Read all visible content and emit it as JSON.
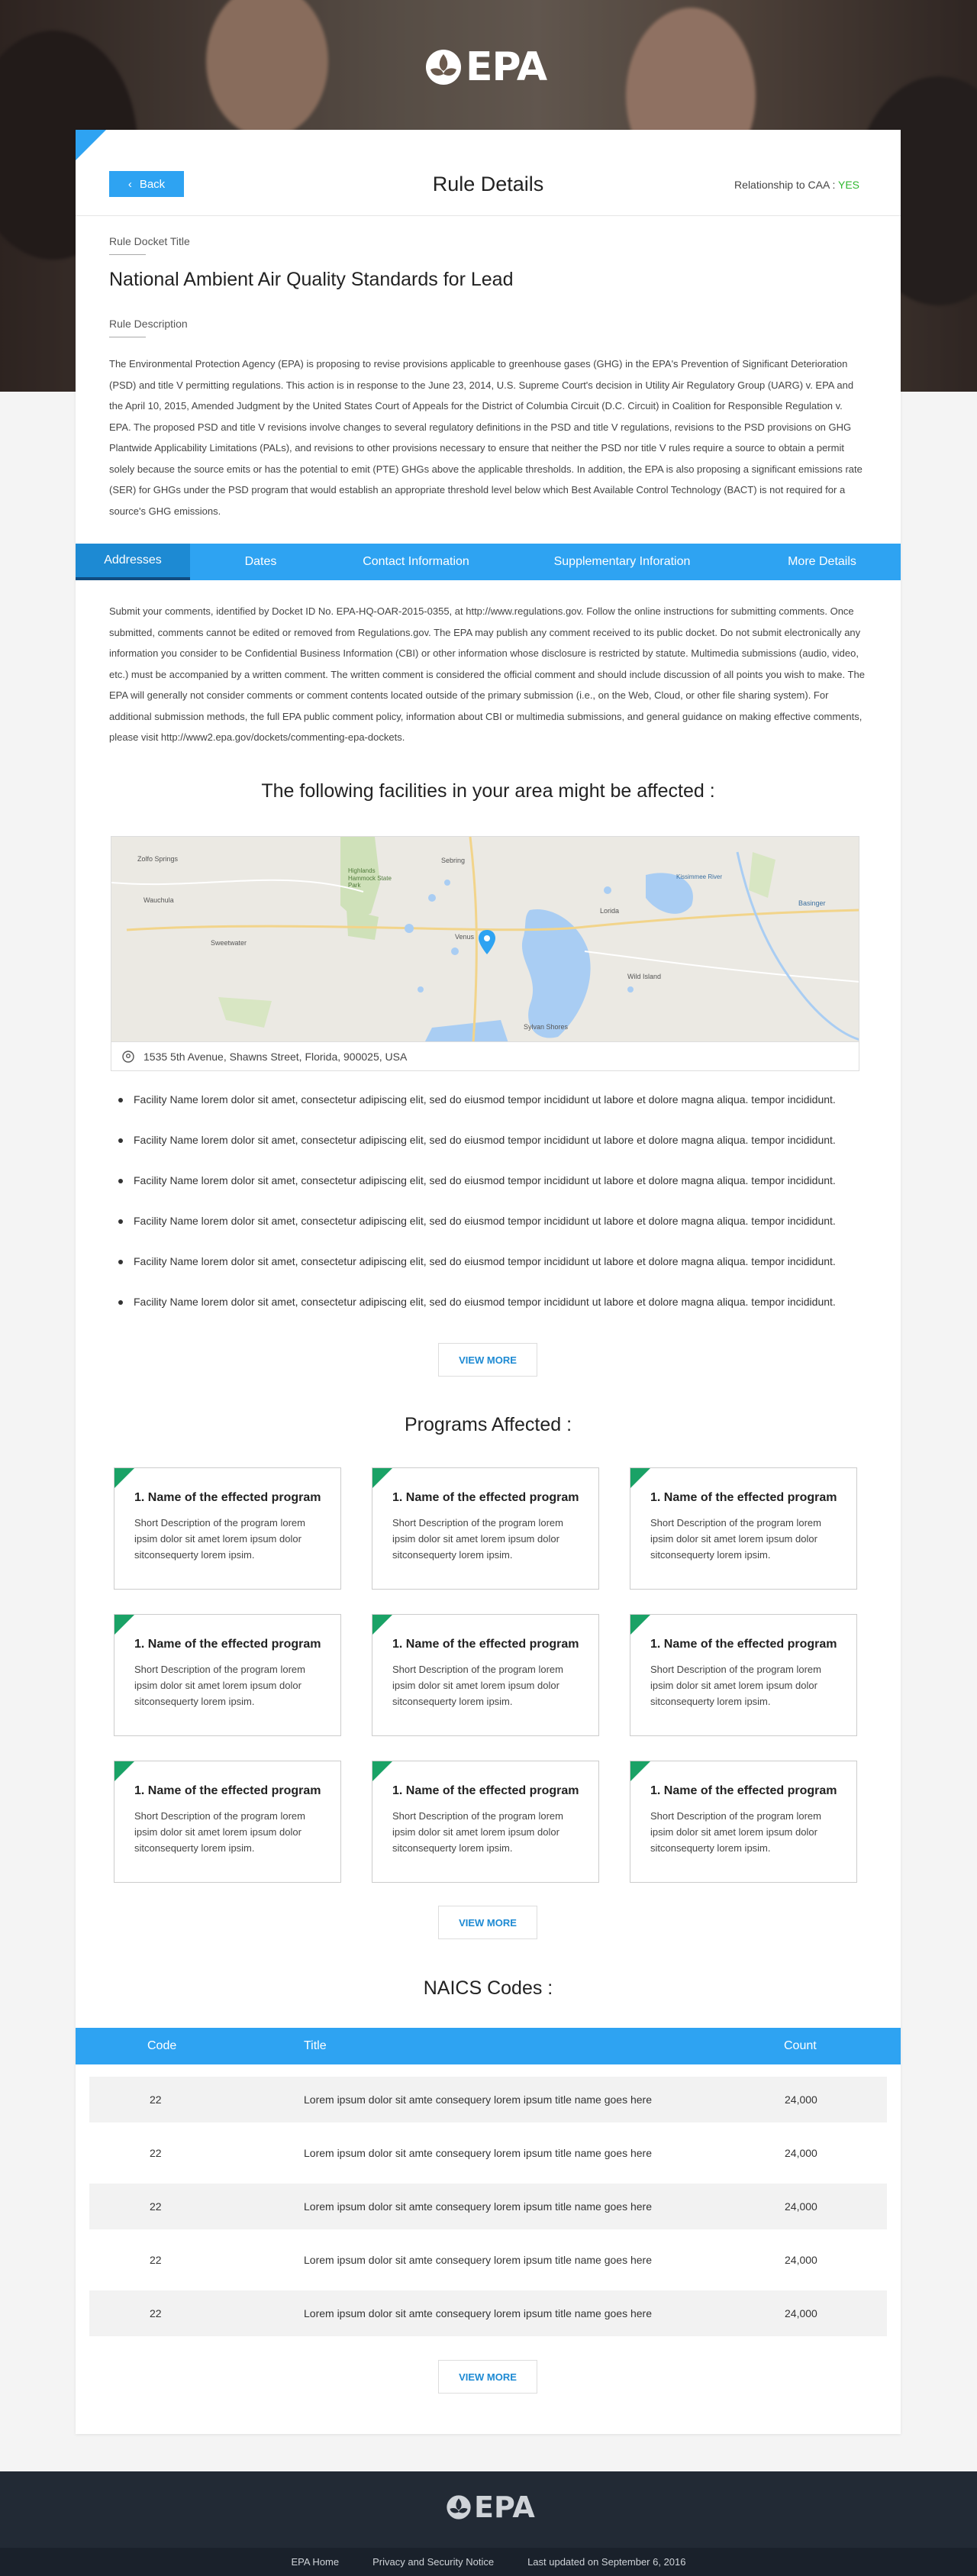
{
  "brand": {
    "logo_text": "EPA",
    "accent": "#2ea3f2",
    "success": "#2eb82e",
    "green_tag": "#1aa266",
    "footer_bg": "#222a35"
  },
  "header": {
    "back_label": "Back",
    "title": "Rule Details",
    "caa_label": "Relationship to CAA : ",
    "caa_value": "YES"
  },
  "rule": {
    "docket_label": "Rule Docket Title",
    "title": "National Ambient Air Quality Standards for Lead",
    "desc_label": "Rule Description",
    "description": "The Environmental Protection Agency (EPA) is proposing to revise provisions applicable to greenhouse gases (GHG) in the EPA's Prevention of Significant Deterioration (PSD) and title V permitting regulations. This action is in response to the June 23, 2014, U.S. Supreme Court's decision in Utility Air Regulatory Group (UARG) v. EPA and the April 10, 2015, Amended Judgment by the United States Court of Appeals for the District of Columbia Circuit (D.C. Circuit) in Coalition for Responsible Regulation v. EPA. The proposed PSD and title V revisions involve changes to several regulatory definitions in the PSD and title V regulations, revisions to the PSD provisions on GHG Plantwide Applicability Limitations (PALs), and revisions to other provisions necessary to ensure that neither the PSD nor title V rules require a source to obtain a permit solely because the source emits or has the potential to emit (PTE) GHGs above the applicable thresholds. In addition, the EPA is also proposing a significant emissions rate (SER) for GHGs under the PSD program that would establish an appropriate threshold level below which Best Available Control Technology (BACT) is not required for a source's GHG emissions."
  },
  "tabs": [
    {
      "label": "Addresses",
      "active": true
    },
    {
      "label": "Dates"
    },
    {
      "label": "Contact Information"
    },
    {
      "label": "Supplementary Inforation"
    },
    {
      "label": "More Details"
    }
  ],
  "submit_text": "Submit your comments, identified by Docket ID No. EPA-HQ-OAR-2015-0355, at http://www.regulations.gov. Follow the online instructions for submitting comments. Once submitted, comments cannot be edited or removed from Regulations.gov. The EPA may publish any comment received to its public docket. Do not submit electronically any information you consider to be Confidential Business Information (CBI) or other information whose disclosure is restricted by statute. Multimedia submissions (audio, video, etc.) must be accompanied by a written comment. The written comment is considered the official comment and should include discussion of all points you wish to make. The EPA will generally not consider comments or comment contents located outside of the primary submission (i.e., on the Web, Cloud, or other file sharing system). For additional submission methods, the full EPA public comment policy, information about CBI or multimedia submissions, and general guidance on making effective comments, please visit http://www2.epa.gov/dockets/commenting-epa-dockets.",
  "facilities_title": "The following facilities in your area might be affected :",
  "map": {
    "address": "1535 5th Avenue, Shawns Street, Florida, 900025, USA",
    "places": [
      "Zolfo Springs",
      "Wauchula",
      "Sebring",
      "Highlands Hammock State Park",
      "Sweetwater",
      "Venus",
      "Lorida",
      "Wild Island",
      "Kissimmee River",
      "Basinger",
      "Sylvan Shores"
    ]
  },
  "facilities": [
    "Facility Name lorem dolor sit amet, consectetur adipiscing elit, sed do eiusmod tempor incididunt ut labore et dolore magna aliqua.  tempor incididunt.",
    "Facility Name lorem dolor sit amet, consectetur adipiscing elit, sed do eiusmod tempor incididunt ut labore et dolore magna aliqua.  tempor incididunt.",
    "Facility Name lorem dolor sit amet, consectetur adipiscing elit, sed do eiusmod tempor incididunt ut labore et dolore magna aliqua.  tempor incididunt.",
    "Facility Name lorem dolor sit amet, consectetur adipiscing elit, sed do eiusmod tempor incididunt ut labore et dolore magna aliqua.  tempor incididunt.",
    "Facility Name lorem dolor sit amet, consectetur adipiscing elit, sed do eiusmod tempor incididunt ut labore et dolore magna aliqua.  tempor incididunt.",
    "Facility Name lorem dolor sit amet, consectetur adipiscing elit, sed do eiusmod tempor incididunt ut labore et dolore magna aliqua.  tempor incididunt."
  ],
  "view_more": "VIEW MORE",
  "programs_title": "Programs Affected :",
  "programs": [
    {
      "name": "1. Name of the effected program",
      "desc": "Short Description of the program lorem ipsim dolor sit amet lorem ipsum dolor sitconsequerty lorem ipsim."
    },
    {
      "name": "1. Name of the effected program",
      "desc": "Short Description of the program lorem ipsim dolor sit amet lorem ipsum dolor sitconsequerty lorem ipsim."
    },
    {
      "name": "1. Name of the effected program",
      "desc": "Short Description of the program lorem ipsim dolor sit amet lorem ipsum dolor sitconsequerty lorem ipsim."
    },
    {
      "name": "1. Name of the effected program",
      "desc": "Short Description of the program lorem ipsim dolor sit amet lorem ipsum dolor sitconsequerty lorem ipsim."
    },
    {
      "name": "1. Name of the effected program",
      "desc": "Short Description of the program lorem ipsim dolor sit amet lorem ipsum dolor sitconsequerty lorem ipsim."
    },
    {
      "name": "1. Name of the effected program",
      "desc": "Short Description of the program lorem ipsim dolor sit amet lorem ipsum dolor sitconsequerty lorem ipsim."
    },
    {
      "name": "1. Name of the effected program",
      "desc": "Short Description of the program lorem ipsim dolor sit amet lorem ipsum dolor sitconsequerty lorem ipsim."
    },
    {
      "name": "1. Name of the effected program",
      "desc": "Short Description of the program lorem ipsim dolor sit amet lorem ipsum dolor sitconsequerty lorem ipsim."
    },
    {
      "name": "1. Name of the effected program",
      "desc": "Short Description of the program lorem ipsim dolor sit amet lorem ipsum dolor sitconsequerty lorem ipsim."
    }
  ],
  "naics_title": "NAICS Codes :",
  "naics": {
    "columns": [
      "Code",
      "Title",
      "Count"
    ],
    "rows": [
      [
        "22",
        "Lorem ipsum dolor sit amte consequery lorem ipsum title name goes here",
        "24,000"
      ],
      [
        "22",
        "Lorem ipsum dolor sit amte consequery lorem ipsum title name goes here",
        "24,000"
      ],
      [
        "22",
        "Lorem ipsum dolor sit amte consequery lorem ipsum title name goes here",
        "24,000"
      ],
      [
        "22",
        "Lorem ipsum dolor sit amte consequery lorem ipsum title name goes here",
        "24,000"
      ],
      [
        "22",
        "Lorem ipsum dolor sit amte consequery lorem ipsum title name goes here",
        "24,000"
      ]
    ]
  },
  "footer": {
    "logo_text": "EPA",
    "links": [
      "EPA Home",
      "Privacy and Security Notice"
    ],
    "updated": "Last updated on September 6, 2016"
  }
}
